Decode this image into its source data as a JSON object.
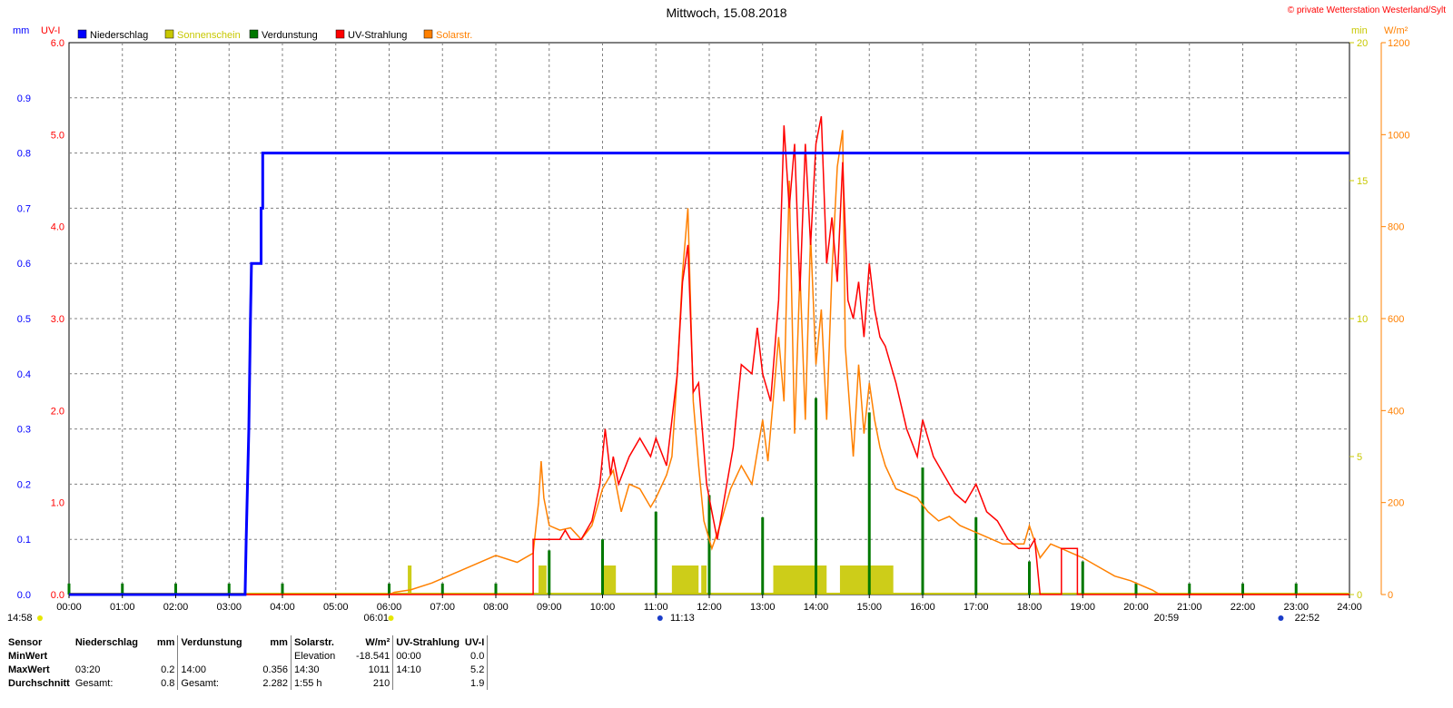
{
  "header": {
    "title": "Mittwoch, 15.08.2018",
    "copyright": "© private Wetterstation Westerland/Sylt"
  },
  "colors": {
    "niederschlag": "#0000ff",
    "sonnenschein": "#c8c800",
    "verdunstung": "#007800",
    "uv": "#ff0000",
    "solar": "#ff8000",
    "grid": "#808080"
  },
  "axis_units": {
    "left_mm": "mm",
    "left_uv": "UV-I",
    "right_min": "min",
    "right_wm2": "W/m²"
  },
  "sun_marks": {
    "start": "14:58",
    "sunrise": "06:01",
    "culmination": "11:13",
    "sunset": "20:59",
    "moon": "22:52"
  },
  "chart_data": {
    "type": "line",
    "x_axis": {
      "ticks": [
        "00:00",
        "01:00",
        "02:00",
        "03:00",
        "04:00",
        "05:00",
        "06:00",
        "07:00",
        "08:00",
        "09:00",
        "10:00",
        "11:00",
        "12:00",
        "13:00",
        "14:00",
        "15:00",
        "16:00",
        "17:00",
        "18:00",
        "19:00",
        "20:00",
        "21:00",
        "22:00",
        "23:00",
        "24:00"
      ],
      "range_hours": [
        0,
        24
      ]
    },
    "y_axes": {
      "mm": {
        "range": [
          0.0,
          1.0
        ],
        "ticks": [
          "0.0",
          "0.1",
          "0.2",
          "0.3",
          "0.4",
          "0.5",
          "0.6",
          "0.7",
          "0.8",
          "0.9"
        ]
      },
      "uv": {
        "range": [
          0.0,
          6.0
        ],
        "ticks": [
          "0.0",
          "1.0",
          "2.0",
          "3.0",
          "4.0",
          "5.0",
          "6.0"
        ]
      },
      "min": {
        "range": [
          0,
          20
        ],
        "ticks": [
          "0",
          "5",
          "10",
          "15",
          "20"
        ]
      },
      "wm2": {
        "range": [
          0,
          1200
        ],
        "ticks": [
          "0",
          "200",
          "400",
          "600",
          "800",
          "1000",
          "1200"
        ]
      }
    },
    "legend": [
      "Niederschlag",
      "Sonnenschein",
      "Verdunstung",
      "UV-Strahlung",
      "Solarstr."
    ],
    "series": [
      {
        "name": "Niederschlag",
        "axis": "mm",
        "points": [
          [
            0,
            0
          ],
          [
            3.3,
            0
          ],
          [
            3.32,
            0.1
          ],
          [
            3.37,
            0.3
          ],
          [
            3.4,
            0.5
          ],
          [
            3.42,
            0.6
          ],
          [
            3.6,
            0.6
          ],
          [
            3.6,
            0.7
          ],
          [
            3.63,
            0.7
          ],
          [
            3.63,
            0.8
          ],
          [
            24,
            0.8
          ]
        ]
      },
      {
        "name": "Verdunstung",
        "axis": "mm",
        "bars": [
          [
            0,
            0.02
          ],
          [
            1,
            0.02
          ],
          [
            2,
            0.02
          ],
          [
            3,
            0.02
          ],
          [
            4,
            0.02
          ],
          [
            6,
            0.02
          ],
          [
            7,
            0.02
          ],
          [
            8,
            0.02
          ],
          [
            9,
            0.08
          ],
          [
            10,
            0.1
          ],
          [
            11,
            0.15
          ],
          [
            12,
            0.18
          ],
          [
            13,
            0.14
          ],
          [
            14,
            0.356
          ],
          [
            15,
            0.33
          ],
          [
            16,
            0.23
          ],
          [
            17,
            0.14
          ],
          [
            18,
            0.06
          ],
          [
            19,
            0.06
          ],
          [
            20,
            0.02
          ],
          [
            21,
            0.02
          ],
          [
            22,
            0.02
          ],
          [
            23,
            0.02
          ]
        ]
      },
      {
        "name": "Sonnenschein",
        "axis": "min",
        "intervals": [
          [
            6.35,
            6.42
          ],
          [
            8.8,
            8.95
          ],
          [
            10.0,
            10.25
          ],
          [
            11.3,
            11.8
          ],
          [
            11.85,
            11.95
          ],
          [
            13.2,
            14.2
          ],
          [
            14.45,
            15.45
          ]
        ],
        "value": 1
      },
      {
        "name": "UV-Strahlung",
        "axis": "uv",
        "points": [
          [
            0,
            0
          ],
          [
            8.7,
            0
          ],
          [
            8.7,
            0.6
          ],
          [
            9.2,
            0.6
          ],
          [
            9.3,
            0.7
          ],
          [
            9.4,
            0.6
          ],
          [
            9.6,
            0.6
          ],
          [
            9.8,
            0.8
          ],
          [
            9.95,
            1.2
          ],
          [
            10.05,
            1.8
          ],
          [
            10.15,
            1.3
          ],
          [
            10.2,
            1.5
          ],
          [
            10.3,
            1.2
          ],
          [
            10.5,
            1.5
          ],
          [
            10.7,
            1.7
          ],
          [
            10.9,
            1.5
          ],
          [
            11.0,
            1.7
          ],
          [
            11.2,
            1.4
          ],
          [
            11.4,
            2.4
          ],
          [
            11.5,
            3.4
          ],
          [
            11.6,
            3.8
          ],
          [
            11.7,
            2.2
          ],
          [
            11.8,
            2.3
          ],
          [
            11.95,
            1.2
          ],
          [
            12.05,
            0.9
          ],
          [
            12.15,
            0.6
          ],
          [
            12.3,
            1.1
          ],
          [
            12.45,
            1.6
          ],
          [
            12.6,
            2.5
          ],
          [
            12.8,
            2.4
          ],
          [
            12.9,
            2.9
          ],
          [
            13.0,
            2.4
          ],
          [
            13.15,
            2.1
          ],
          [
            13.3,
            3.2
          ],
          [
            13.4,
            5.1
          ],
          [
            13.5,
            4.2
          ],
          [
            13.6,
            4.9
          ],
          [
            13.7,
            3.3
          ],
          [
            13.8,
            4.9
          ],
          [
            13.9,
            3.8
          ],
          [
            14.0,
            4.9
          ],
          [
            14.1,
            5.2
          ],
          [
            14.2,
            3.6
          ],
          [
            14.3,
            4.1
          ],
          [
            14.4,
            3.4
          ],
          [
            14.5,
            4.7
          ],
          [
            14.6,
            3.2
          ],
          [
            14.7,
            3.0
          ],
          [
            14.8,
            3.4
          ],
          [
            14.9,
            2.8
          ],
          [
            15.0,
            3.6
          ],
          [
            15.1,
            3.1
          ],
          [
            15.2,
            2.8
          ],
          [
            15.3,
            2.7
          ],
          [
            15.5,
            2.3
          ],
          [
            15.7,
            1.8
          ],
          [
            15.9,
            1.5
          ],
          [
            16.0,
            1.9
          ],
          [
            16.2,
            1.5
          ],
          [
            16.4,
            1.3
          ],
          [
            16.6,
            1.1
          ],
          [
            16.8,
            1.0
          ],
          [
            17.0,
            1.2
          ],
          [
            17.2,
            0.9
          ],
          [
            17.4,
            0.8
          ],
          [
            17.6,
            0.6
          ],
          [
            17.8,
            0.5
          ],
          [
            18.0,
            0.5
          ],
          [
            18.1,
            0.6
          ],
          [
            18.2,
            0.0
          ],
          [
            18.6,
            0.0
          ],
          [
            18.6,
            0.5
          ],
          [
            18.9,
            0.5
          ],
          [
            18.9,
            0.0
          ],
          [
            24,
            0
          ]
        ]
      },
      {
        "name": "Solarstr.",
        "axis": "wm2",
        "points": [
          [
            0,
            0
          ],
          [
            6.0,
            0
          ],
          [
            6.1,
            5
          ],
          [
            6.4,
            10
          ],
          [
            6.8,
            25
          ],
          [
            7.2,
            45
          ],
          [
            7.6,
            65
          ],
          [
            8.0,
            85
          ],
          [
            8.4,
            70
          ],
          [
            8.7,
            90
          ],
          [
            8.8,
            200
          ],
          [
            8.85,
            290
          ],
          [
            8.9,
            210
          ],
          [
            9.0,
            150
          ],
          [
            9.2,
            140
          ],
          [
            9.4,
            145
          ],
          [
            9.6,
            120
          ],
          [
            9.8,
            150
          ],
          [
            10.0,
            230
          ],
          [
            10.2,
            270
          ],
          [
            10.35,
            180
          ],
          [
            10.5,
            240
          ],
          [
            10.7,
            230
          ],
          [
            10.9,
            190
          ],
          [
            11.0,
            210
          ],
          [
            11.2,
            260
          ],
          [
            11.3,
            300
          ],
          [
            11.4,
            480
          ],
          [
            11.5,
            700
          ],
          [
            11.6,
            840
          ],
          [
            11.7,
            420
          ],
          [
            11.8,
            280
          ],
          [
            11.9,
            160
          ],
          [
            12.05,
            100
          ],
          [
            12.2,
            150
          ],
          [
            12.4,
            230
          ],
          [
            12.6,
            280
          ],
          [
            12.8,
            240
          ],
          [
            13.0,
            380
          ],
          [
            13.1,
            290
          ],
          [
            13.3,
            560
          ],
          [
            13.4,
            420
          ],
          [
            13.5,
            900
          ],
          [
            13.6,
            350
          ],
          [
            13.7,
            700
          ],
          [
            13.8,
            380
          ],
          [
            13.9,
            780
          ],
          [
            14.0,
            500
          ],
          [
            14.1,
            620
          ],
          [
            14.2,
            380
          ],
          [
            14.3,
            700
          ],
          [
            14.4,
            930
          ],
          [
            14.5,
            1010
          ],
          [
            14.55,
            540
          ],
          [
            14.7,
            300
          ],
          [
            14.8,
            500
          ],
          [
            14.9,
            350
          ],
          [
            15.0,
            460
          ],
          [
            15.1,
            380
          ],
          [
            15.2,
            320
          ],
          [
            15.3,
            280
          ],
          [
            15.5,
            230
          ],
          [
            15.7,
            220
          ],
          [
            15.9,
            210
          ],
          [
            16.1,
            180
          ],
          [
            16.3,
            160
          ],
          [
            16.5,
            170
          ],
          [
            16.7,
            150
          ],
          [
            16.9,
            140
          ],
          [
            17.1,
            130
          ],
          [
            17.3,
            120
          ],
          [
            17.5,
            110
          ],
          [
            17.7,
            110
          ],
          [
            17.9,
            110
          ],
          [
            18.0,
            150
          ],
          [
            18.2,
            80
          ],
          [
            18.4,
            110
          ],
          [
            18.6,
            100
          ],
          [
            18.8,
            90
          ],
          [
            19.0,
            80
          ],
          [
            19.3,
            60
          ],
          [
            19.6,
            40
          ],
          [
            19.9,
            30
          ],
          [
            20.1,
            20
          ],
          [
            20.3,
            10
          ],
          [
            20.45,
            0
          ],
          [
            24,
            0
          ]
        ]
      }
    ]
  },
  "stats": {
    "row_labels": [
      "Sensor",
      "MinWert",
      "MaxWert",
      "Durchschnitt"
    ],
    "niederschlag": {
      "title": "Niederschlag",
      "unit": "mm",
      "max_time": "03:20",
      "max": "0.2",
      "avg_label": "Gesamt:",
      "avg": "0.8"
    },
    "verdunstung": {
      "title": "Verdunstung",
      "unit": "mm",
      "max_time": "14:00",
      "max": "0.356",
      "avg_label": "Gesamt:",
      "avg": "2.282"
    },
    "solar": {
      "title": "Solarstr.",
      "unit": "W/m²",
      "min_label": "Elevation",
      "min": "-18.541",
      "max_time": "14:30",
      "max": "1011",
      "avg_label": "1:55 h",
      "avg": "210"
    },
    "uv": {
      "title": "UV-Strahlung",
      "unit": "UV-I",
      "min_time": "00:00",
      "min": "0.0",
      "max_time": "14:10",
      "max": "5.2",
      "avg": "1.9"
    }
  }
}
